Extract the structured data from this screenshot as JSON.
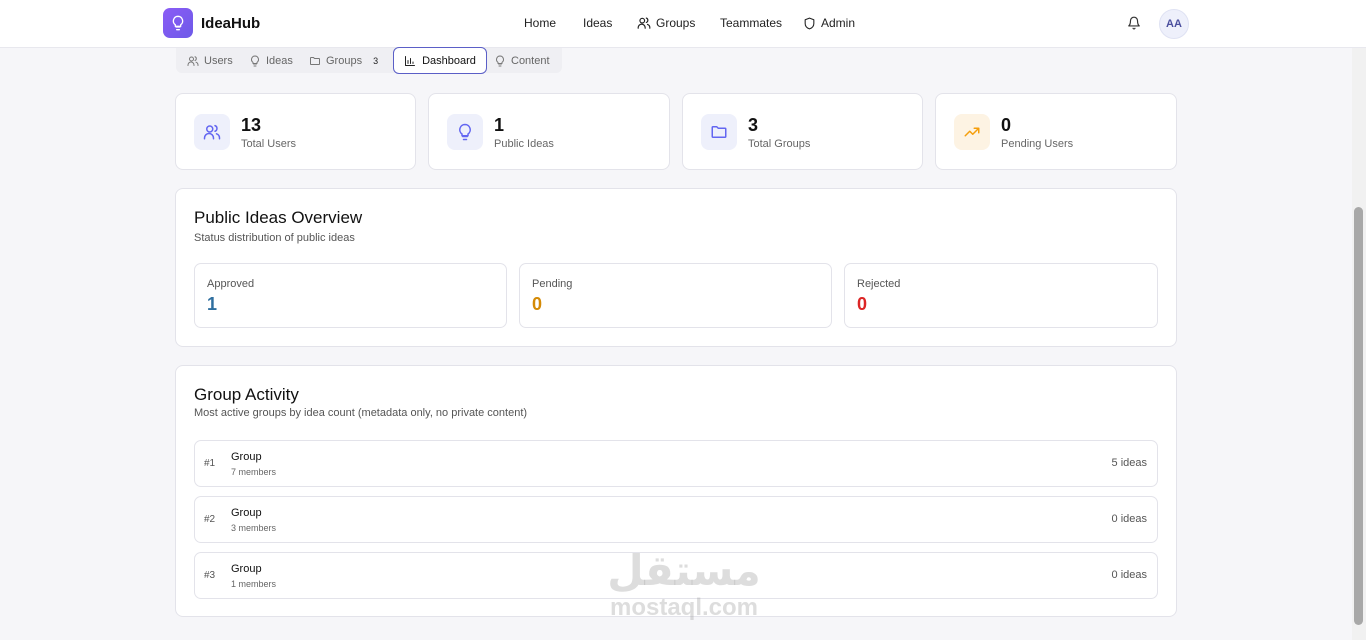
{
  "app": {
    "brand": "IdeaHub",
    "user_initials": "AA"
  },
  "nav": [
    {
      "label": "Home",
      "icon": ""
    },
    {
      "label": "Ideas",
      "icon": ""
    },
    {
      "label": "Groups",
      "icon": "users-icon"
    },
    {
      "label": "Teammates",
      "icon": ""
    },
    {
      "label": "Admin",
      "icon": "shield-icon"
    }
  ],
  "tabs": {
    "users": "Users",
    "ideas": "Ideas",
    "groups": "Groups",
    "groups_count": "3",
    "dashboard": "Dashboard",
    "content": "Content",
    "active": "Dashboard"
  },
  "stats": [
    {
      "value": "13",
      "label": "Total Users",
      "icon": "users-icon",
      "color": "#6366f1"
    },
    {
      "value": "1",
      "label": "Public Ideas",
      "icon": "lightbulb-icon",
      "color": "#6366f1"
    },
    {
      "value": "3",
      "label": "Total Groups",
      "icon": "folder-icon",
      "color": "#6366f1"
    },
    {
      "value": "0",
      "label": "Pending Users",
      "icon": "trending-up-icon",
      "color": "#f59e0b"
    }
  ],
  "overview": {
    "title": "Public Ideas Overview",
    "subtitle": "Status distribution of public ideas",
    "statuses": [
      {
        "label": "Approved",
        "value": "1",
        "color": "#2f6f9f"
      },
      {
        "label": "Pending",
        "value": "0",
        "color": "#d48a06"
      },
      {
        "label": "Rejected",
        "value": "0",
        "color": "#dc2626"
      }
    ]
  },
  "activity": {
    "title": "Group Activity",
    "subtitle": "Most active groups by idea count (metadata only, no private content)",
    "groups": [
      {
        "rank": "#1",
        "name": "Group",
        "members": "7 members",
        "ideas": "5 ideas"
      },
      {
        "rank": "#2",
        "name": "Group",
        "members": "3 members",
        "ideas": "0 ideas"
      },
      {
        "rank": "#3",
        "name": "Group",
        "members": "1 members",
        "ideas": "0 ideas"
      }
    ]
  },
  "watermark": {
    "arabic": "مستقل",
    "latin": "mostaql.com"
  }
}
